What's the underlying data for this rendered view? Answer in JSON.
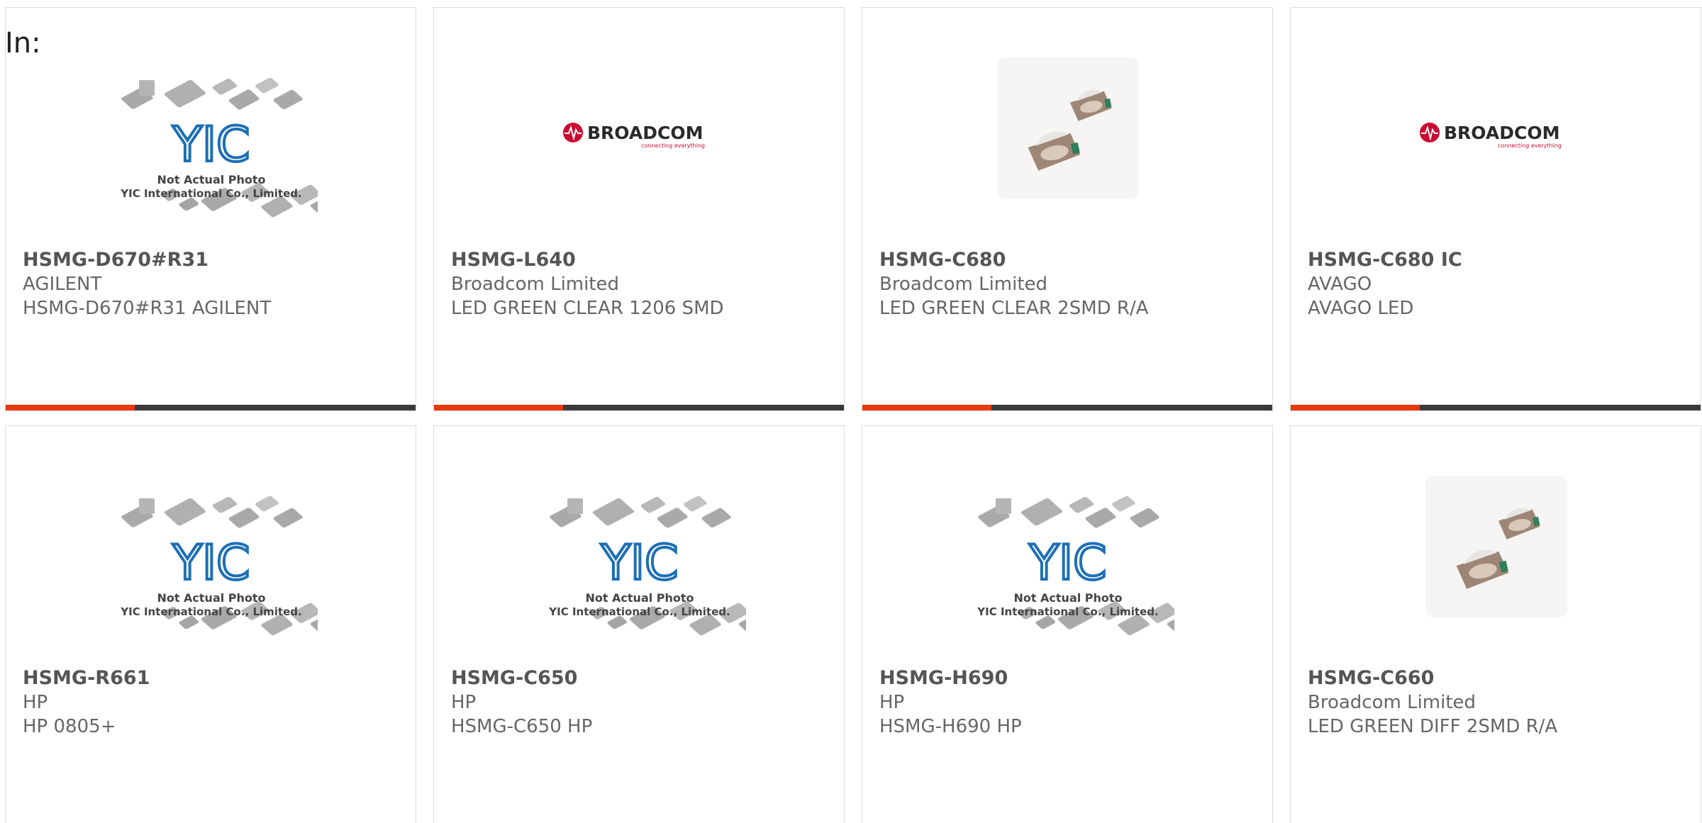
{
  "filter": {
    "in_label": "In:"
  },
  "colors": {
    "accent": "#e8380d",
    "bar": "#3a3a3a",
    "broadcom_red": "#cc092f"
  },
  "placeholder": {
    "line1": "Not Actual Photo",
    "line2": "YIC International Co., Limited.",
    "logo_text": "YIC"
  },
  "broadcom": {
    "name": "BROADCOM",
    "tagline": "connecting everything"
  },
  "products": [
    {
      "part": "HSMG-D670#R31",
      "manufacturer": "AGILENT",
      "description": "HSMG-D670#R31 AGILENT",
      "image": "yic-placeholder"
    },
    {
      "part": "HSMG-L640",
      "manufacturer": "Broadcom Limited",
      "description": "LED GREEN CLEAR 1206 SMD",
      "image": "broadcom-logo"
    },
    {
      "part": "HSMG-C680",
      "manufacturer": "Broadcom Limited",
      "description": "LED GREEN CLEAR 2SMD R/A",
      "image": "led-photo"
    },
    {
      "part": "HSMG-C680 IC",
      "manufacturer": "AVAGO",
      "description": "AVAGO LED",
      "image": "broadcom-logo"
    },
    {
      "part": "HSMG-R661",
      "manufacturer": "HP",
      "description": "HP 0805+",
      "image": "yic-placeholder"
    },
    {
      "part": "HSMG-C650",
      "manufacturer": "HP",
      "description": "HSMG-C650 HP",
      "image": "yic-placeholder"
    },
    {
      "part": "HSMG-H690",
      "manufacturer": "HP",
      "description": "HSMG-H690 HP",
      "image": "yic-placeholder"
    },
    {
      "part": "HSMG-C660",
      "manufacturer": "Broadcom Limited",
      "description": "LED GREEN DIFF 2SMD R/A",
      "image": "led-photo"
    }
  ]
}
